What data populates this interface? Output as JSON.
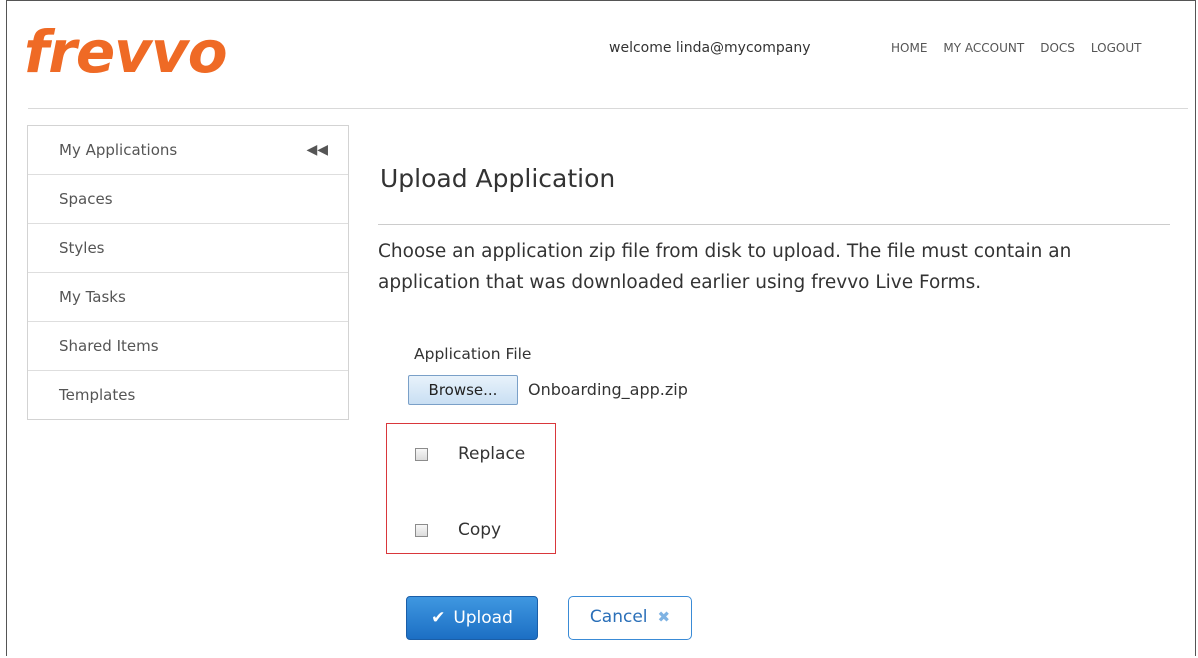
{
  "header": {
    "logo": "frevvo",
    "welcome": "welcome linda@mycompany",
    "nav": [
      "HOME",
      "MY ACCOUNT",
      "DOCS",
      "LOGOUT"
    ]
  },
  "sidebar": {
    "collapse_icon": "double-chevron-left-icon",
    "items": [
      "My Applications",
      "Spaces",
      "Styles",
      "My Tasks",
      "Shared Items",
      "Templates"
    ]
  },
  "main": {
    "title": "Upload Application",
    "description": "Choose an application zip file from disk to upload. The file must contain an application that was downloaded earlier using frevvo Live Forms.",
    "file_label": "Application File",
    "browse_label": "Browse...",
    "file_name": "Onboarding_app.zip",
    "options": [
      {
        "label": "Replace",
        "checked": false
      },
      {
        "label": "Copy",
        "checked": false
      }
    ],
    "upload_label": "Upload",
    "cancel_label": "Cancel"
  },
  "colors": {
    "brand": "#ef6a25",
    "primary": "#1c6fc4",
    "highlight": "#d9373b"
  }
}
